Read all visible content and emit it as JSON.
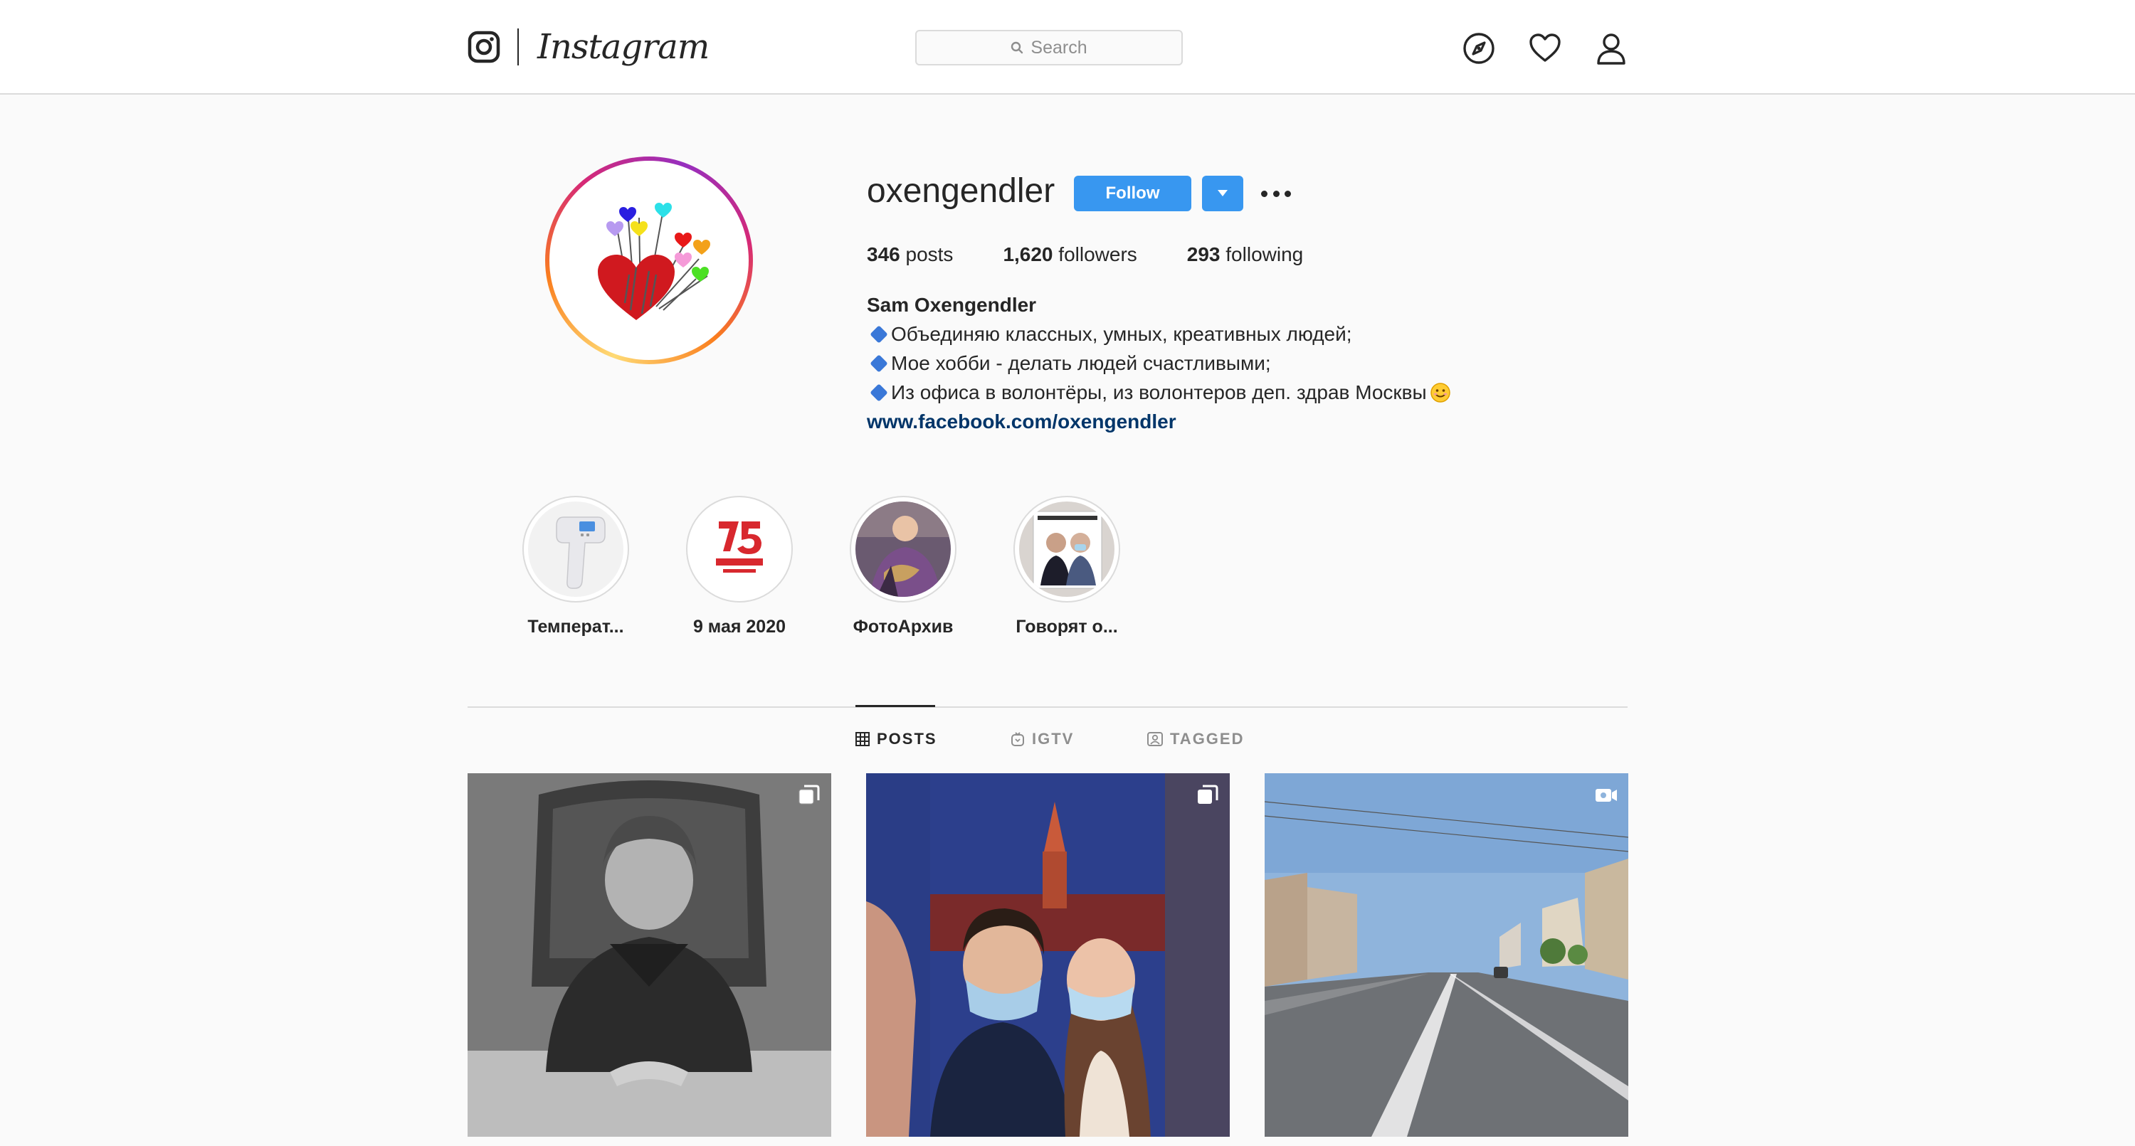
{
  "nav": {
    "wordmark": "Instagram",
    "search_placeholder": "Search",
    "icons": [
      "instagram-glyph-icon",
      "search-icon",
      "explore-icon",
      "heart-icon",
      "profile-icon"
    ]
  },
  "profile": {
    "username": "oxengendler",
    "follow_label": "Follow",
    "stats": {
      "posts_count": "346",
      "posts_label": "posts",
      "followers_count": "1,620",
      "followers_label": "followers",
      "following_count": "293",
      "following_label": "following"
    },
    "full_name": "Sam Oxengendler",
    "bio_lines": [
      "Объединяю классных, умных, креативных людей;",
      "Мое хобби - делать людей счастливыми;",
      "Из офиса в волонтёры, из волонтеров деп. здрав Москвы"
    ],
    "link": "www.facebook.com/oxengendler"
  },
  "highlights": [
    {
      "label": "Температ..."
    },
    {
      "label": "9 мая 2020"
    },
    {
      "label": "ФотоАрхив"
    },
    {
      "label": "Говорят о..."
    }
  ],
  "tabs": [
    {
      "label": "POSTS",
      "active": true
    },
    {
      "label": "IGTV",
      "active": false
    },
    {
      "label": "TAGGED",
      "active": false
    }
  ],
  "posts": [
    {
      "type": "carousel"
    },
    {
      "type": "carousel"
    },
    {
      "type": "video"
    }
  ],
  "colors": {
    "accent": "#3897f0",
    "link": "#003569",
    "border": "#dbdbdb",
    "background": "#fafafa"
  }
}
